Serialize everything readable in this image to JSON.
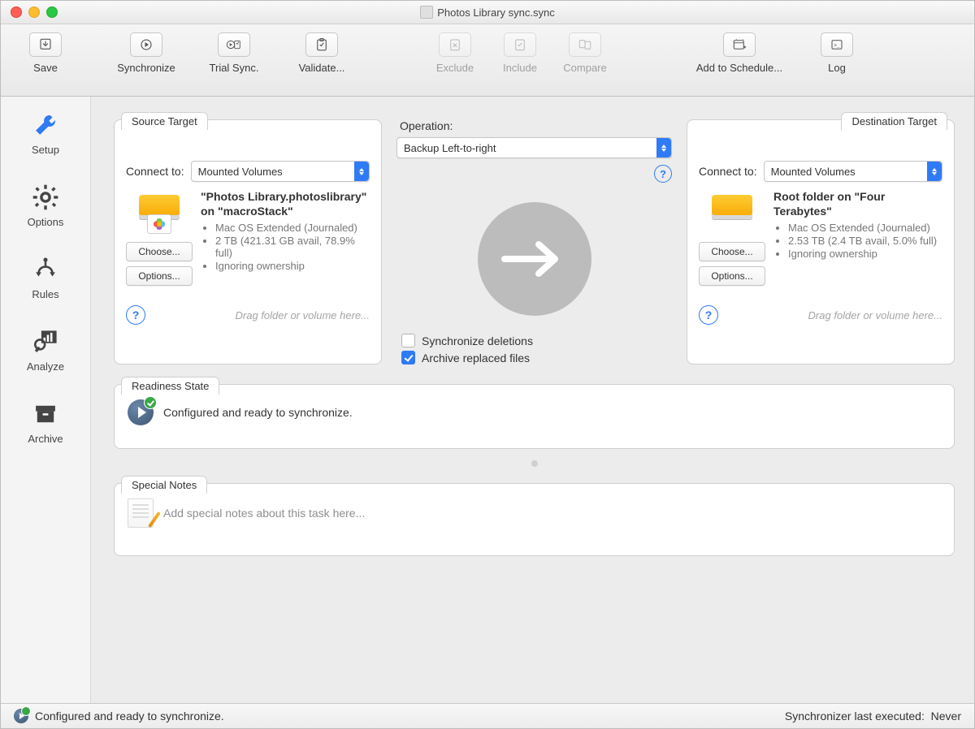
{
  "window": {
    "title": "Photos Library sync.sync"
  },
  "toolbar": {
    "save": "Save",
    "synchronize": "Synchronize",
    "trial": "Trial Sync.",
    "validate": "Validate...",
    "exclude": "Exclude",
    "include": "Include",
    "compare": "Compare",
    "schedule": "Add to Schedule...",
    "log": "Log"
  },
  "sidebar": {
    "setup": "Setup",
    "options": "Options",
    "rules": "Rules",
    "analyze": "Analyze",
    "archive": "Archive"
  },
  "source": {
    "tab": "Source Target",
    "connect_label": "Connect to:",
    "connect_value": "Mounted Volumes",
    "title": "\"Photos Library.photoslibrary\" on \"macroStack\"",
    "bullet1": "Mac OS Extended (Journaled)",
    "bullet2": "2 TB (421.31 GB avail, 78.9% full)",
    "bullet3": "Ignoring ownership",
    "choose": "Choose...",
    "options": "Options...",
    "drag": "Drag folder or volume here..."
  },
  "destination": {
    "tab": "Destination Target",
    "connect_label": "Connect to:",
    "connect_value": "Mounted Volumes",
    "title": "Root folder on \"Four Terabytes\"",
    "bullet1": "Mac OS Extended (Journaled)",
    "bullet2": "2.53 TB (2.4 TB avail, 5.0% full)",
    "bullet3": "Ignoring ownership",
    "choose": "Choose...",
    "options": "Options...",
    "drag": "Drag folder or volume here..."
  },
  "operation": {
    "label": "Operation:",
    "value": "Backup Left-to-right",
    "sync_deletions": "Synchronize deletions",
    "archive_replaced": "Archive replaced files"
  },
  "readiness": {
    "tab": "Readiness State",
    "text": "Configured and ready to synchronize."
  },
  "notes": {
    "tab": "Special Notes",
    "placeholder": "Add special notes about this task here..."
  },
  "status": {
    "left": "Configured and ready to synchronize.",
    "right_label": "Synchronizer last executed:",
    "right_value": "Never"
  }
}
